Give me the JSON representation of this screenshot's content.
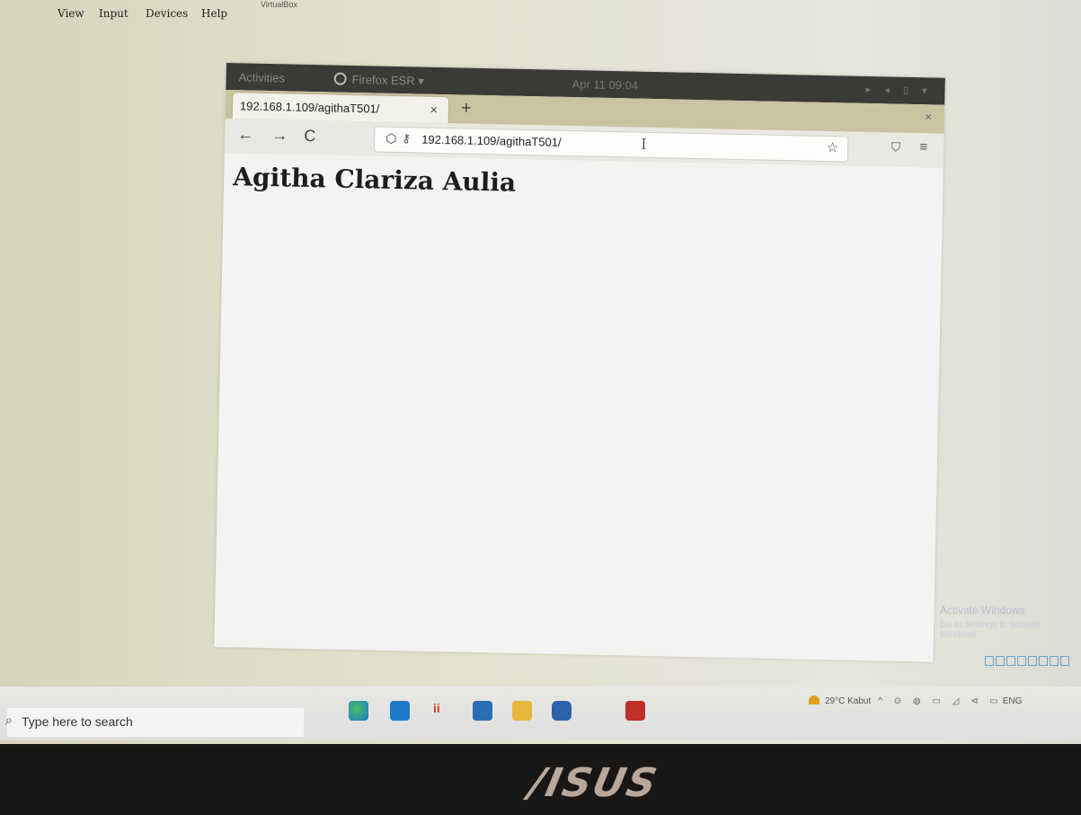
{
  "vbox": {
    "menu": [
      "View",
      "Input",
      "Devices",
      "Help"
    ],
    "cut_title": "VirtualBox"
  },
  "gnome": {
    "activities": "Activities",
    "app": "Firefox ESR ▾",
    "clock": "Apr 11  09:04",
    "tray": "▸ ◂ ▯ ▾"
  },
  "browser": {
    "tab_title": "192.168.1.109/agithaT501/",
    "tab_close": "×",
    "new_tab": "+",
    "window_close": "×",
    "back": "←",
    "forward": "→",
    "reload": "C",
    "url": "192.168.1.109/agithaT501/",
    "bookmark_star": "☆",
    "pocket": "⛉",
    "menu": "≡"
  },
  "page": {
    "heading": "Agitha Clariza Aulia"
  },
  "watermark": {
    "title": "Activate Windows",
    "subtitle": "Go to Settings to activate Windows."
  },
  "taskbar": {
    "search_placeholder": "Type here to search",
    "weather": "29°C  Kabut",
    "tray_icons": "^ ⊙ ◍ ▭ ◿ ⊲ ▭",
    "lang": "ENG",
    "apps": [
      "edge",
      "store",
      "office",
      "mail",
      "files",
      "virtualbox",
      "terminal"
    ]
  },
  "bezel": {
    "brand": "/ISUS"
  },
  "colors": {
    "taskbar_blue": "#1e78c8",
    "edge_green": "#2c8a5a",
    "virtualbox_red": "#c0302a"
  }
}
